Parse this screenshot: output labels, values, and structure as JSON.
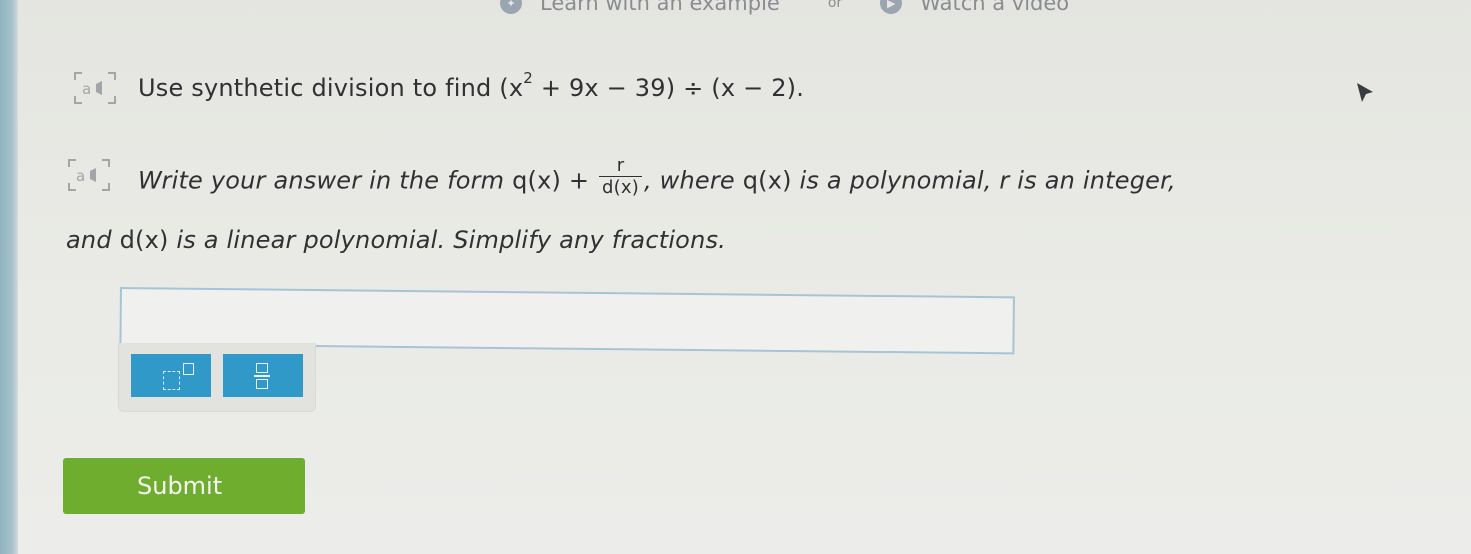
{
  "topbar": {
    "learn_label": "Learn with an example",
    "or_label": "or",
    "video_label": "Watch a video"
  },
  "question": {
    "instruction_text": "Use synthetic division to find",
    "dividend_open": "(x",
    "exponent": "2",
    "dividend_rest": " + 9x − 39) ÷ (x − 2).",
    "form_intro": "Write your answer in the form ",
    "form_q": "q(x) + ",
    "frac_numerator": "r",
    "frac_denominator": "d(x)",
    "form_mid": ", where ",
    "form_q2": "q(x)",
    "form_tail": " is a polynomial, r is an integer,",
    "line3_intro": "and ",
    "line3_d": "d(x)",
    "line3_tail": " is a linear polynomial. Simplify any fractions."
  },
  "answer": {
    "value": ""
  },
  "toolbar": {
    "exponent_tool_icon": "exponent-template-icon",
    "fraction_tool_icon": "fraction-template-icon"
  },
  "submit": {
    "label": "Submit"
  },
  "colors": {
    "tool_blue": "#3199c8",
    "submit_green": "#6fad2f",
    "input_border": "#a6c4d3"
  }
}
